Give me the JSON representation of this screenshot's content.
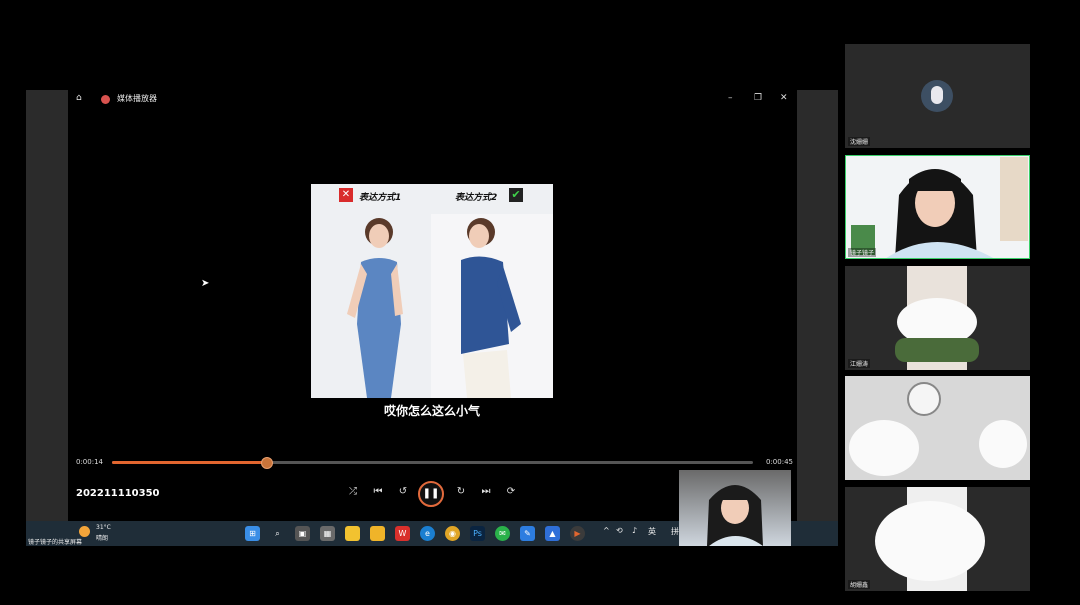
{
  "player": {
    "title": "媒体播放器",
    "filename": "202211110350",
    "time_current": "0:00:14",
    "time_total": "0:00:45",
    "progress": 0.24,
    "video": {
      "left_caption": "表达方式1",
      "right_caption": "表达方式2",
      "subtitle": "哎你怎么这么小气"
    }
  },
  "taskbar": {
    "share_label": "镜子镜子的共享屏幕",
    "weather_temp": "31°C",
    "weather_desc": "晴朗",
    "ime_lang": "英",
    "ime_mode": "拼"
  },
  "participants": [
    {
      "name": "沈姗姗"
    },
    {
      "name": "镜子镜子"
    },
    {
      "name": "江姗涛"
    },
    {
      "name": ""
    },
    {
      "name": "胡姗鑫"
    }
  ],
  "colors": {
    "accent": "#e2662f",
    "taskbar": "#1f2d38"
  }
}
